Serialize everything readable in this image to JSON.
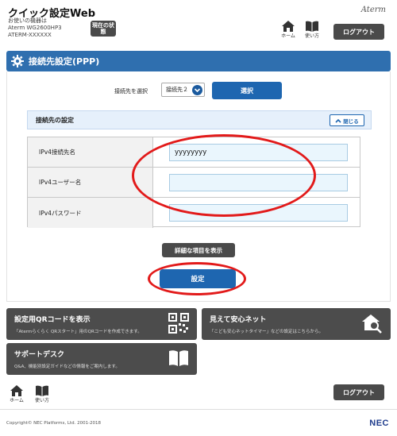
{
  "header": {
    "app_title": "クイック設定Web",
    "device_prefix": "お使いの機器は",
    "device_model": "Aterm WG2600HP3",
    "device_name": "ATERM-XXXXXX",
    "status_button": "現在の状態",
    "brand": "Aterm",
    "home_label": "ホーム",
    "manual_label": "使い方",
    "logout_label": "ログアウト"
  },
  "section": {
    "title": "接続先設定(PPP)"
  },
  "selector": {
    "label": "接続先を選択",
    "selected_value": "接続先２",
    "select_button": "選択"
  },
  "panel": {
    "title": "接続先の設定",
    "close_label": "閉じる",
    "rows": [
      {
        "label": "IPv4接続先名",
        "value": "yyyyyyyy"
      },
      {
        "label": "IPv4ユーザー名",
        "value": ""
      },
      {
        "label": "IPv4パスワード",
        "value": ""
      }
    ],
    "detail_button": "詳細な項目を表示",
    "save_button": "設定"
  },
  "cards": {
    "qr": {
      "title": "設定用QRコードを表示",
      "desc": "「Atermらくらく QRスタート」用のQRコードを作成できます。"
    },
    "safety": {
      "title": "見えて安心ネット",
      "desc": "「こども安心ネットタイマー」などの設定はこちらから。"
    },
    "support": {
      "title": "サポートデスク",
      "desc": "Q&A、機能別設定ガイドなどの情報をご案内します。"
    }
  },
  "footer": {
    "home_label": "ホーム",
    "manual_label": "使い方",
    "logout_label": "ログアウト",
    "copyright": "Copyright© NEC Platforms, Ltd. 2001-2018",
    "vendor": "NEC"
  },
  "colors": {
    "accent": "#2f6faf",
    "button_blue": "#1e66b0",
    "dark": "#4c4c4c",
    "highlight": "#e21a1a"
  }
}
